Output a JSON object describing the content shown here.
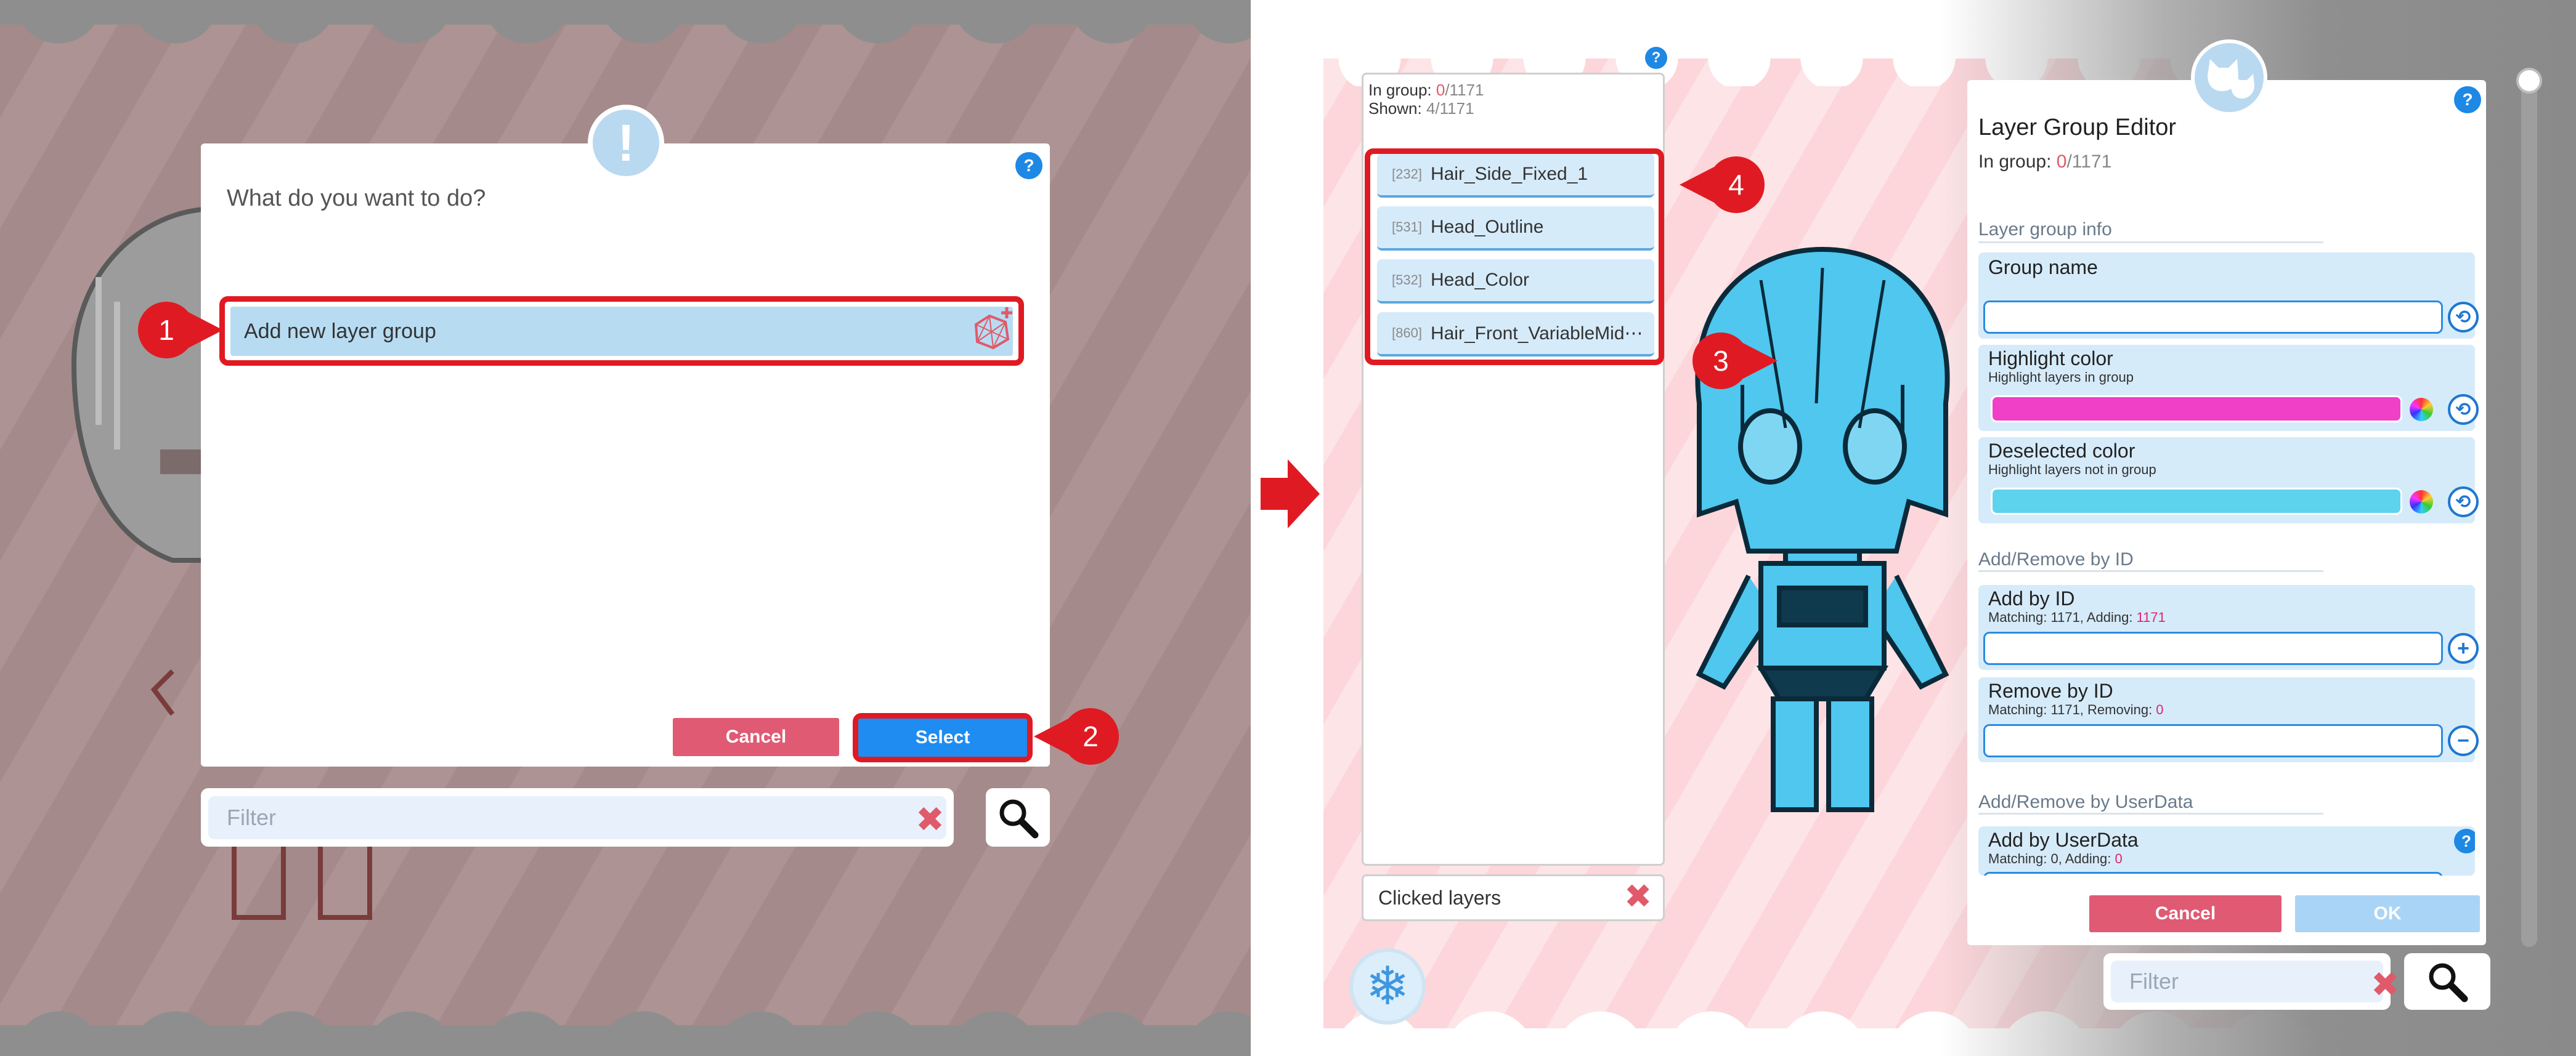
{
  "left": {
    "prompt": "What do you want to do?",
    "option_label": "Add new layer group",
    "cancel_label": "Cancel",
    "select_label": "Select",
    "filter_placeholder": "Filter",
    "markers": [
      "1",
      "2"
    ],
    "help_label": "?"
  },
  "arrow_icon": "right-arrow-icon",
  "right": {
    "list": {
      "in_group_label": "In group: ",
      "in_group_value": "0",
      "in_group_total": "/1171",
      "shown_label": "Shown: ",
      "shown_value": "4/1171",
      "items": [
        {
          "id": "[232]",
          "name": "Hair_Side_Fixed_1"
        },
        {
          "id": "[531]",
          "name": "Head_Outline"
        },
        {
          "id": "[532]",
          "name": "Head_Color"
        },
        {
          "id": "[860]",
          "name": "Hair_Front_VariableMid⋯"
        }
      ],
      "clicked_label": "Clicked layers",
      "help_label": "?"
    },
    "markers": [
      "3",
      "4"
    ],
    "editor": {
      "title": "Layer Group Editor",
      "in_group_label": "In group: ",
      "in_group_value": "0",
      "in_group_total": "/1171",
      "help_label": "?",
      "section_info": "Layer group info",
      "group_name_label": "Group name",
      "group_name_value": "",
      "highlight_label": "Highlight color",
      "highlight_sub": "Highlight layers in group",
      "highlight_color": "#f040c8",
      "deselected_label": "Deselected color",
      "deselected_sub": "Highlight layers not in group",
      "deselected_color": "#5dd3ee",
      "section_id": "Add/Remove by ID",
      "add_id_label": "Add by ID",
      "add_id_sub": "Matching: 1171, Adding: ",
      "add_id_count": "1171",
      "remove_id_label": "Remove by ID",
      "remove_id_sub": "Matching: 1171, Removing: ",
      "remove_id_count": "0",
      "section_userdata": "Add/Remove by UserData",
      "add_ud_label": "Add by UserData",
      "add_ud_sub": "Matching: 0, Adding: ",
      "add_ud_count": "0",
      "cancel_label": "Cancel",
      "ok_label": "OK"
    },
    "filter_placeholder": "Filter"
  },
  "colors": {
    "accent_red": "#e01a22",
    "select_blue": "#1e8cf0",
    "cancel_pink": "#e05a73",
    "layer_blue": "#d6ebfa",
    "character_cyan": "#4fc7ee"
  }
}
